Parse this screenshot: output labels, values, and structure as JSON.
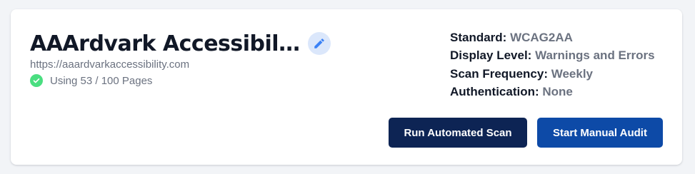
{
  "site": {
    "title": "AAArdvark Accessibil…",
    "url": "https://aaardvarkaccessibility.com",
    "usage": "Using 53 / 100 Pages"
  },
  "details": {
    "standard_label": "Standard:",
    "standard_value": "WCAG2AA",
    "display_level_label": "Display Level:",
    "display_level_value": "Warnings and Errors",
    "scan_frequency_label": "Scan Frequency:",
    "scan_frequency_value": "Weekly",
    "authentication_label": "Authentication:",
    "authentication_value": "None"
  },
  "actions": {
    "run_scan_label": "Run Automated Scan",
    "manual_audit_label": "Start Manual Audit"
  },
  "icons": {
    "edit": "pencil-icon",
    "usage": "check-circle-icon"
  },
  "colors": {
    "run_scan_bg": "#0d2454",
    "manual_audit_bg": "#0d4aa7",
    "edit_icon": "#3b82f6",
    "check_icon": "#4ade80"
  }
}
